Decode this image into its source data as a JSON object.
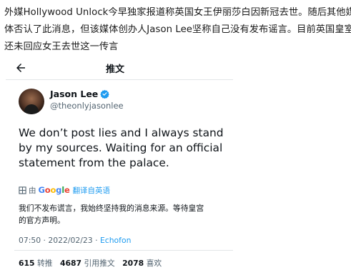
{
  "article": {
    "lines": [
      "外媒Hollywood Unlock今早独家报道称英国女王伊丽莎白因新冠去世。随后其他媒",
      "体否认了此消息，但该媒体创办人Jason Lee坚称自己没有发布谣言。目前英国皇室",
      "还未回应女王去世这一传言"
    ]
  },
  "tweet": {
    "header_title": "推文",
    "display_name": "Jason Lee",
    "handle": "@theonlyjasonlee",
    "text_lines": [
      "We don’t post lies and I always stand",
      "by my sources. Waiting for an official",
      "statement from the palace."
    ],
    "translate": {
      "prefix": "由",
      "google": [
        "G",
        "o",
        "o",
        "g",
        "l",
        "e"
      ],
      "link_label": "翻译自英语"
    },
    "translated_lines": [
      "我们不发布谎言，我始终坚持我的消息来源。等待皇宫",
      "的官方声明。"
    ],
    "meta": {
      "time": "07:50",
      "separator": " · ",
      "date": "2022/02/23",
      "source": "Echofon"
    },
    "stats": {
      "retweets_count": "615",
      "retweets_label": "转推",
      "quotes_count": "4687",
      "quotes_label": "引用推文",
      "likes_count": "2078",
      "likes_label": "喜欢"
    }
  },
  "colors": {
    "accent": "#1d9bf0",
    "secondary_text": "#536471",
    "primary_text": "#0f1419"
  },
  "icons": {
    "back": "arrow-left-icon",
    "verified": "verified-badge-icon",
    "translate": "grid-icon"
  }
}
